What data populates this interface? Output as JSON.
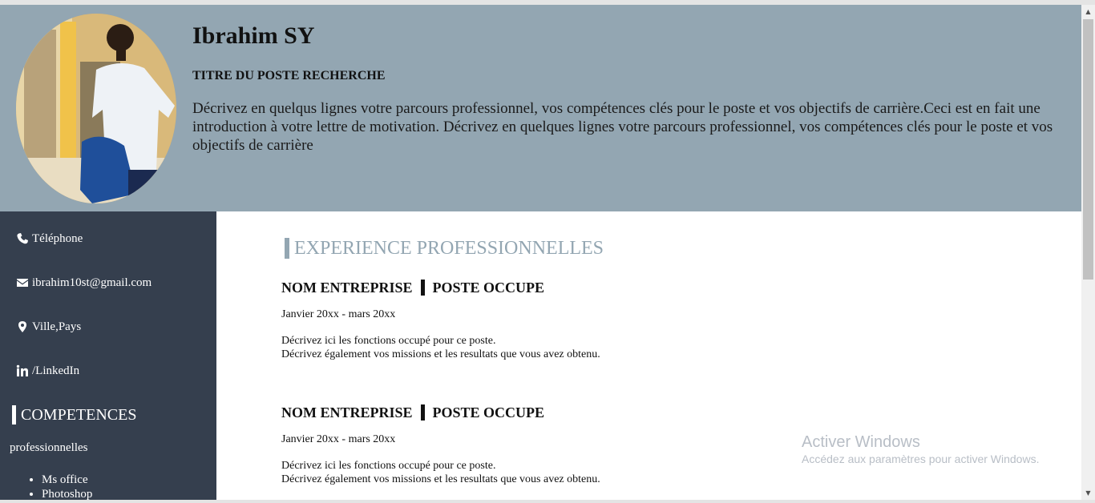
{
  "header": {
    "name": "Ibrahim SY",
    "job_title": "TITRE DU POSTE RECHERCHE",
    "intro": "Décrivez en quelqus lignes votre parcours professionnel, vos compétences clés pour le poste et vos objectifs de carrière.Ceci est en fait une introduction à votre lettre de motivation. Décrivez en quelques lignes votre parcours professionnel, vos compétences clés pour le poste et vos objectifs de carrière"
  },
  "sidebar": {
    "contacts": [
      {
        "icon": "phone-icon",
        "label": "Téléphone"
      },
      {
        "icon": "envelope-icon",
        "label": "ibrahim10st@gmail.com"
      },
      {
        "icon": "location-pin-icon",
        "label": "Ville,Pays"
      },
      {
        "icon": "linkedin-icon",
        "label": "/LinkedIn"
      }
    ],
    "skills_title": "COMPETENCES",
    "skills_subtitle": "professionnelles",
    "skills": [
      "Ms office",
      "Photoshop"
    ]
  },
  "main": {
    "section_title": "EXPERIENCE PROFESSIONNELLES",
    "experiences": [
      {
        "company": "NOM ENTREPRISE",
        "position": "POSTE OCCUPE",
        "dates": "Janvier 20xx - mars 20xx",
        "description_line1": "Décrivez ici les fonctions occupé pour ce poste.",
        "description_line2": "Décrivez également vos missions et les resultats que vous avez obtenu."
      },
      {
        "company": "NOM ENTREPRISE",
        "position": "POSTE OCCUPE",
        "dates": "Janvier 20xx - mars 20xx",
        "description_line1": "Décrivez ici les fonctions occupé pour ce poste.",
        "description_line2": "Décrivez également vos missions et les resultats que vous avez obtenu."
      }
    ]
  },
  "watermark": {
    "title": "Activer Windows",
    "subtitle": "Accédez aux paramètres pour activer Windows."
  },
  "colors": {
    "header_bg": "#93a6b2",
    "sidebar_bg": "#353f4e",
    "accent": "#93a6b2"
  }
}
